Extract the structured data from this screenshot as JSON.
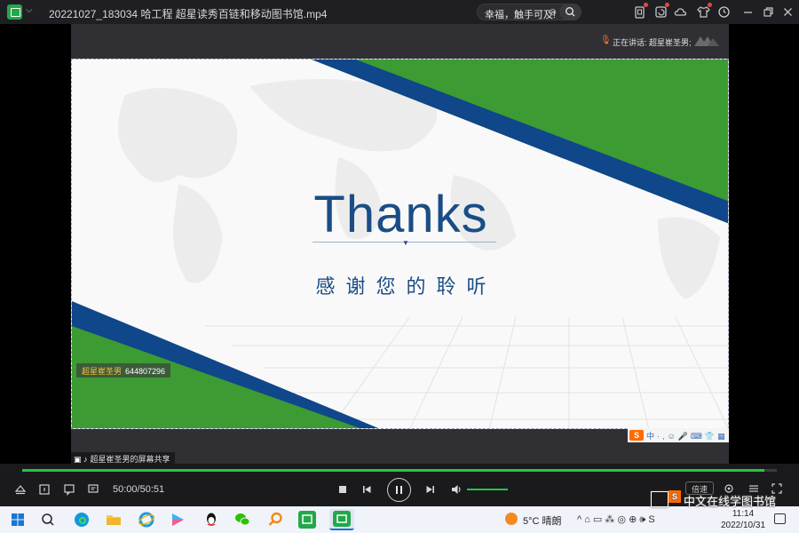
{
  "window": {
    "title": "20221027_183034 哈工程 超星读秀百链和移动图书馆.mp4",
    "search_text": "幸福，触手可及!",
    "search_clear": "⊗"
  },
  "meeting": {
    "speaking_prefix": "正在讲话: ",
    "speaking_name": "超星崔圣男;",
    "user_badge_name": "超星崔圣男",
    "user_badge_id": "644807296",
    "share_label": "超星崔圣男的屏幕共享"
  },
  "slide": {
    "title": "Thanks",
    "subtitle": "感谢您的聆听"
  },
  "ime": {
    "logo": "S",
    "items": "中·,☺🎤⌨👕▦"
  },
  "player": {
    "time": "50:00/50:51",
    "progress_fraction": 0.983,
    "volume_fraction": 1.0,
    "speed_label": "倍速"
  },
  "taskbar": {
    "weather": "5°C  晴朗",
    "tray": "^  ⌂  ▭  ⁂  ◎  ⊕  🕪  S",
    "time": "11:14",
    "date": "2022/10/31"
  },
  "watermark": {
    "logo": "S",
    "text": "中文在线学图书馆"
  },
  "colors": {
    "slide_green": "#3c9b32",
    "slide_blue": "#10468a",
    "title_blue": "#1a4d86",
    "progress_green": "#22c840",
    "accent_orange": "#ff6a00"
  }
}
